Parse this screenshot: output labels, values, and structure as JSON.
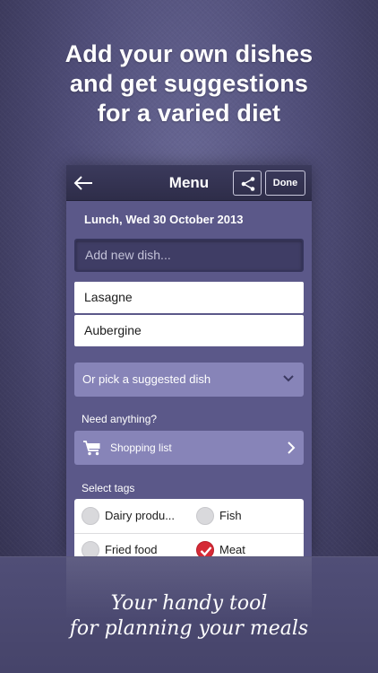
{
  "headline": {
    "line1": "Add your own dishes",
    "line2": "and get suggestions",
    "line3": "for a varied diet"
  },
  "navbar": {
    "back_icon": "arrow-left-icon",
    "title": "Menu",
    "share_icon": "share-icon",
    "done_label": "Done"
  },
  "meal": {
    "date_label": "Lunch, Wed 30 October 2013"
  },
  "add_dish": {
    "placeholder": "Add new dish..."
  },
  "dishes": [
    "Lasagne",
    "Aubergine"
  ],
  "suggest": {
    "label": "Or pick a suggested dish",
    "icon": "chevron-down-icon"
  },
  "need_anything": {
    "label": "Need anything?",
    "shopping_label": "Shopping list",
    "cart_icon": "shopping-cart-icon",
    "arrow_icon": "chevron-right-icon"
  },
  "tags": {
    "label": "Select tags",
    "items": [
      {
        "name": "Dairy produ...",
        "checked": false
      },
      {
        "name": "Fish",
        "checked": false
      },
      {
        "name": "Fried food",
        "checked": false
      },
      {
        "name": "Meat",
        "checked": true
      }
    ]
  },
  "tagline": {
    "line1": "Your handy tool",
    "line2": "for planning your meals"
  },
  "colors": {
    "accent_check": "#d52a36",
    "button_purple": "#8784b8",
    "panel_purple": "#5b5889"
  }
}
